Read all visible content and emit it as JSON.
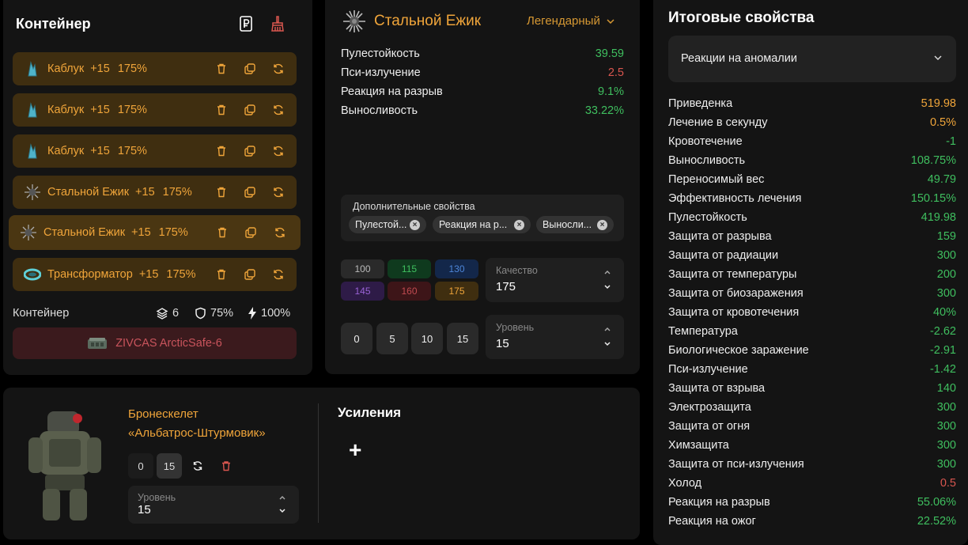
{
  "container": {
    "title": "Контейнер",
    "slots": [
      {
        "name": "Каблук",
        "upgrade": "+15",
        "quality": "175%",
        "icon": "kabluk-icon"
      },
      {
        "name": "Каблук",
        "upgrade": "+15",
        "quality": "175%",
        "icon": "kabluk-icon"
      },
      {
        "name": "Каблук",
        "upgrade": "+15",
        "quality": "175%",
        "icon": "kabluk-icon"
      },
      {
        "name": "Стальной Ежик",
        "upgrade": "+15",
        "quality": "175%",
        "icon": "hedgehog-icon"
      },
      {
        "name": "Стальной Ежик",
        "upgrade": "+15",
        "quality": "175%",
        "icon": "hedgehog-icon"
      },
      {
        "name": "Трансформатор",
        "upgrade": "+15",
        "quality": "175%",
        "icon": "transformer-icon"
      }
    ],
    "footer_label": "Контейнер",
    "slots_count": "6",
    "protection": "75%",
    "energy": "100%",
    "container_name": "ZIVCAS ArcticSafe-6"
  },
  "artifact": {
    "name": "Стальной Ежик",
    "rarity": "Легендарный",
    "props": [
      {
        "label": "Пулестойкость",
        "value": "39.59",
        "color": "#3fbf5f"
      },
      {
        "label": "Пси-излучение",
        "value": "2.5",
        "color": "#d9564f"
      },
      {
        "label": "Реакция на разрыв",
        "value": "9.1%",
        "color": "#3fbf5f"
      },
      {
        "label": "Выносливость",
        "value": "33.22%",
        "color": "#3fbf5f"
      }
    ],
    "extra_title": "Дополнительные свойства",
    "chips": [
      "Пулестой...",
      "Реакция на р...",
      "Выносли..."
    ],
    "quality_buttons": [
      "100",
      "115",
      "130",
      "145",
      "160",
      "175"
    ],
    "quality_label": "Качество",
    "quality_value": "175",
    "level_buttons": [
      "0",
      "5",
      "10",
      "15"
    ],
    "level_label": "Уровень",
    "level_value": "15"
  },
  "armor": {
    "name_line1": "Бронескелет",
    "name_line2": "«Альбатрос-Штурмовик»",
    "btn_0": "0",
    "btn_15": "15",
    "level_label": "Уровень",
    "level_value": "15",
    "boosts_title": "Усиления",
    "add_label": "+"
  },
  "final": {
    "title": "Итоговые свойства",
    "selected": "Реакции на аномалии",
    "rows": [
      {
        "label": "Приведенка",
        "value": "519.98",
        "color": "#f0a53a"
      },
      {
        "label": "Лечение в секунду",
        "value": "0.5%",
        "color": "#f0a53a"
      },
      {
        "label": "Кровотечение",
        "value": "-1",
        "color": "#3fbf5f"
      },
      {
        "label": "Выносливость",
        "value": "108.75%",
        "color": "#3fbf5f"
      },
      {
        "label": "Переносимый вес",
        "value": "49.79",
        "color": "#3fbf5f"
      },
      {
        "label": "Эффективность лечения",
        "value": "150.15%",
        "color": "#3fbf5f"
      },
      {
        "label": "Пулестойкость",
        "value": "419.98",
        "color": "#3fbf5f"
      },
      {
        "label": "Защита от разрыва",
        "value": "159",
        "color": "#3fbf5f"
      },
      {
        "label": "Защита от радиации",
        "value": "300",
        "color": "#3fbf5f"
      },
      {
        "label": "Защита от температуры",
        "value": "200",
        "color": "#3fbf5f"
      },
      {
        "label": "Защита от биозаражения",
        "value": "300",
        "color": "#3fbf5f"
      },
      {
        "label": "Защита от кровотечения",
        "value": "40%",
        "color": "#3fbf5f"
      },
      {
        "label": "Температура",
        "value": "-2.62",
        "color": "#3fbf5f"
      },
      {
        "label": "Биологическое заражение",
        "value": "-2.91",
        "color": "#3fbf5f"
      },
      {
        "label": "Пси-излучение",
        "value": "-1.42",
        "color": "#3fbf5f"
      },
      {
        "label": "Защита от взрыва",
        "value": "140",
        "color": "#3fbf5f"
      },
      {
        "label": "Электрозащита",
        "value": "300",
        "color": "#3fbf5f"
      },
      {
        "label": "Защита от огня",
        "value": "300",
        "color": "#3fbf5f"
      },
      {
        "label": "Химзащита",
        "value": "300",
        "color": "#3fbf5f"
      },
      {
        "label": "Защита от пси-излучения",
        "value": "300",
        "color": "#3fbf5f"
      },
      {
        "label": "Холод",
        "value": "0.5",
        "color": "#d9564f"
      },
      {
        "label": "Реакция на разрыв",
        "value": "55.06%",
        "color": "#3fbf5f"
      },
      {
        "label": "Реакция на ожог",
        "value": "22.52%",
        "color": "#3fbf5f"
      }
    ]
  }
}
